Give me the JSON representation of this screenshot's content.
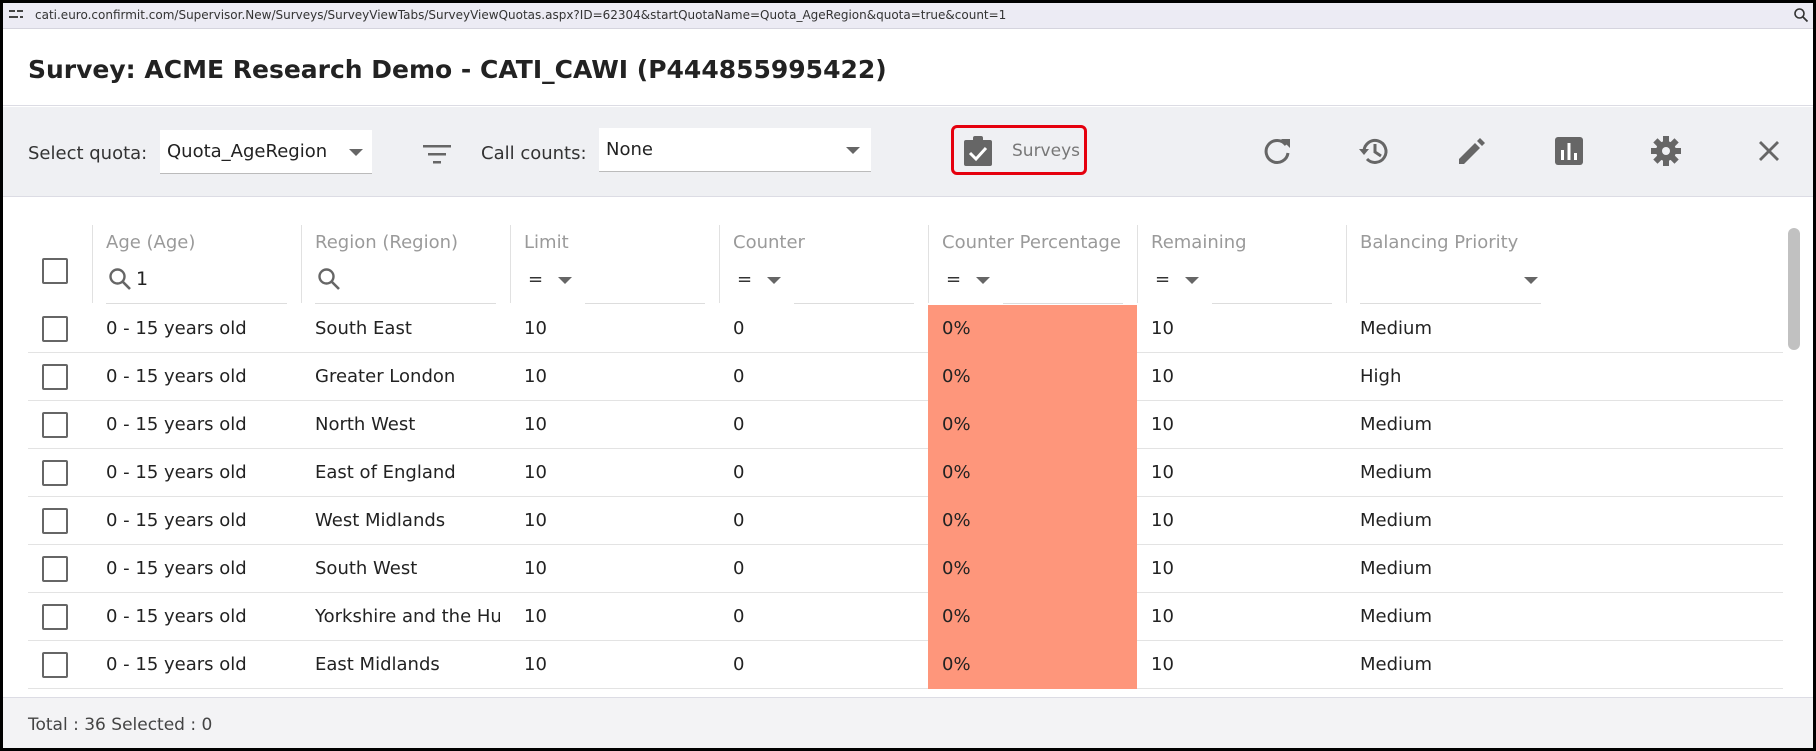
{
  "browser": {
    "url": "cati.euro.confirmit.com/Supervisor.New/Surveys/SurveyViewTabs/SurveyViewQuotas.aspx?ID=62304&startQuotaName=Quota_AgeRegion&quota=true&count=1"
  },
  "page": {
    "title": "Survey: ACME Research Demo - CATI_CAWI (P444855995422)"
  },
  "toolbar": {
    "select_quota_label": "Select quota:",
    "select_quota_value": "Quota_AgeRegion",
    "call_counts_label": "Call counts:",
    "call_counts_value": "None",
    "surveys_button_label": "Surveys",
    "icons": [
      "filter-icon",
      "refresh-icon",
      "history-icon",
      "edit-icon",
      "chart-icon",
      "settings-icon",
      "close-icon"
    ]
  },
  "grid": {
    "columns": {
      "age": {
        "title": "Age (Age)",
        "filter_value": "1"
      },
      "region": {
        "title": "Region (Region)",
        "filter_value": ""
      },
      "limit": {
        "title": "Limit",
        "operator": "="
      },
      "counter": {
        "title": "Counter",
        "operator": "="
      },
      "counter_percentage": {
        "title": "Counter Percentage",
        "operator": "="
      },
      "remaining": {
        "title": "Remaining",
        "operator": "="
      },
      "balancing_priority": {
        "title": "Balancing Priority"
      }
    },
    "highlight_color": "#fe967b",
    "rows": [
      {
        "age": "0 - 15 years old",
        "region": "South East",
        "limit": "10",
        "counter": "0",
        "pct": "0%",
        "remaining": "10",
        "priority": "Medium"
      },
      {
        "age": "0 - 15 years old",
        "region": "Greater London",
        "limit": "10",
        "counter": "0",
        "pct": "0%",
        "remaining": "10",
        "priority": "High"
      },
      {
        "age": "0 - 15 years old",
        "region": "North West",
        "limit": "10",
        "counter": "0",
        "pct": "0%",
        "remaining": "10",
        "priority": "Medium"
      },
      {
        "age": "0 - 15 years old",
        "region": "East of England",
        "limit": "10",
        "counter": "0",
        "pct": "0%",
        "remaining": "10",
        "priority": "Medium"
      },
      {
        "age": "0 - 15 years old",
        "region": "West Midlands",
        "limit": "10",
        "counter": "0",
        "pct": "0%",
        "remaining": "10",
        "priority": "Medium"
      },
      {
        "age": "0 - 15 years old",
        "region": "South West",
        "limit": "10",
        "counter": "0",
        "pct": "0%",
        "remaining": "10",
        "priority": "Medium"
      },
      {
        "age": "0 - 15 years old",
        "region": "Yorkshire and the Hu…",
        "limit": "10",
        "counter": "0",
        "pct": "0%",
        "remaining": "10",
        "priority": "Medium"
      },
      {
        "age": "0 - 15 years old",
        "region": "East Midlands",
        "limit": "10",
        "counter": "0",
        "pct": "0%",
        "remaining": "10",
        "priority": "Medium"
      }
    ]
  },
  "footer": {
    "summary": "Total : 36 Selected : 0"
  }
}
